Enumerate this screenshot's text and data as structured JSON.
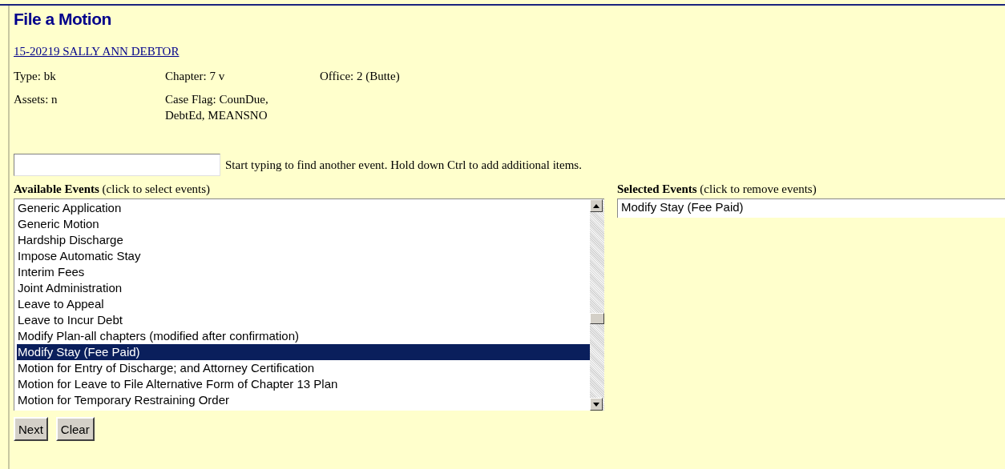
{
  "title": "File a Motion",
  "case_link": "15-20219 SALLY ANN DEBTOR",
  "case_info": [
    {
      "label": "Type: bk",
      "kind": "text"
    },
    {
      "label": "Chapter: 7 v",
      "kind": "text"
    },
    {
      "label": "Office: 2 (Butte)",
      "kind": "text"
    },
    {
      "label": "Assets: n",
      "kind": "text"
    },
    {
      "label": "Case Flag: CounDue, DebtEd, MEANSNO",
      "kind": "text"
    }
  ],
  "search": {
    "hint": "Start typing to find another event. Hold down Ctrl to add additional items."
  },
  "available": {
    "heading": "Available Events",
    "note": "(click to select events)",
    "items": [
      {
        "label": "Generic Application",
        "selected": false
      },
      {
        "label": "Generic Motion",
        "selected": false
      },
      {
        "label": "Hardship Discharge",
        "selected": false
      },
      {
        "label": "Impose Automatic Stay",
        "selected": false
      },
      {
        "label": "Interim Fees",
        "selected": false
      },
      {
        "label": "Joint Administration",
        "selected": false
      },
      {
        "label": "Leave to Appeal",
        "selected": false
      },
      {
        "label": "Leave to Incur Debt",
        "selected": false
      },
      {
        "label": "Modify Plan-all chapters (modified after confirmation)",
        "selected": false
      },
      {
        "label": "Modify Stay (Fee Paid)",
        "selected": true
      },
      {
        "label": "Motion for Entry of Discharge; and Attorney Certification",
        "selected": false
      },
      {
        "label": "Motion for Leave to File Alternative Form of Chapter 13 Plan",
        "selected": false
      },
      {
        "label": "Motion for Temporary Restraining Order",
        "selected": false
      }
    ]
  },
  "selected_events": {
    "heading": "Selected Events",
    "note": "(click to remove events)",
    "items": [
      {
        "label": "Modify Stay (Fee Paid)",
        "selected": false
      }
    ]
  },
  "buttons": [
    "Next",
    "Clear"
  ]
}
